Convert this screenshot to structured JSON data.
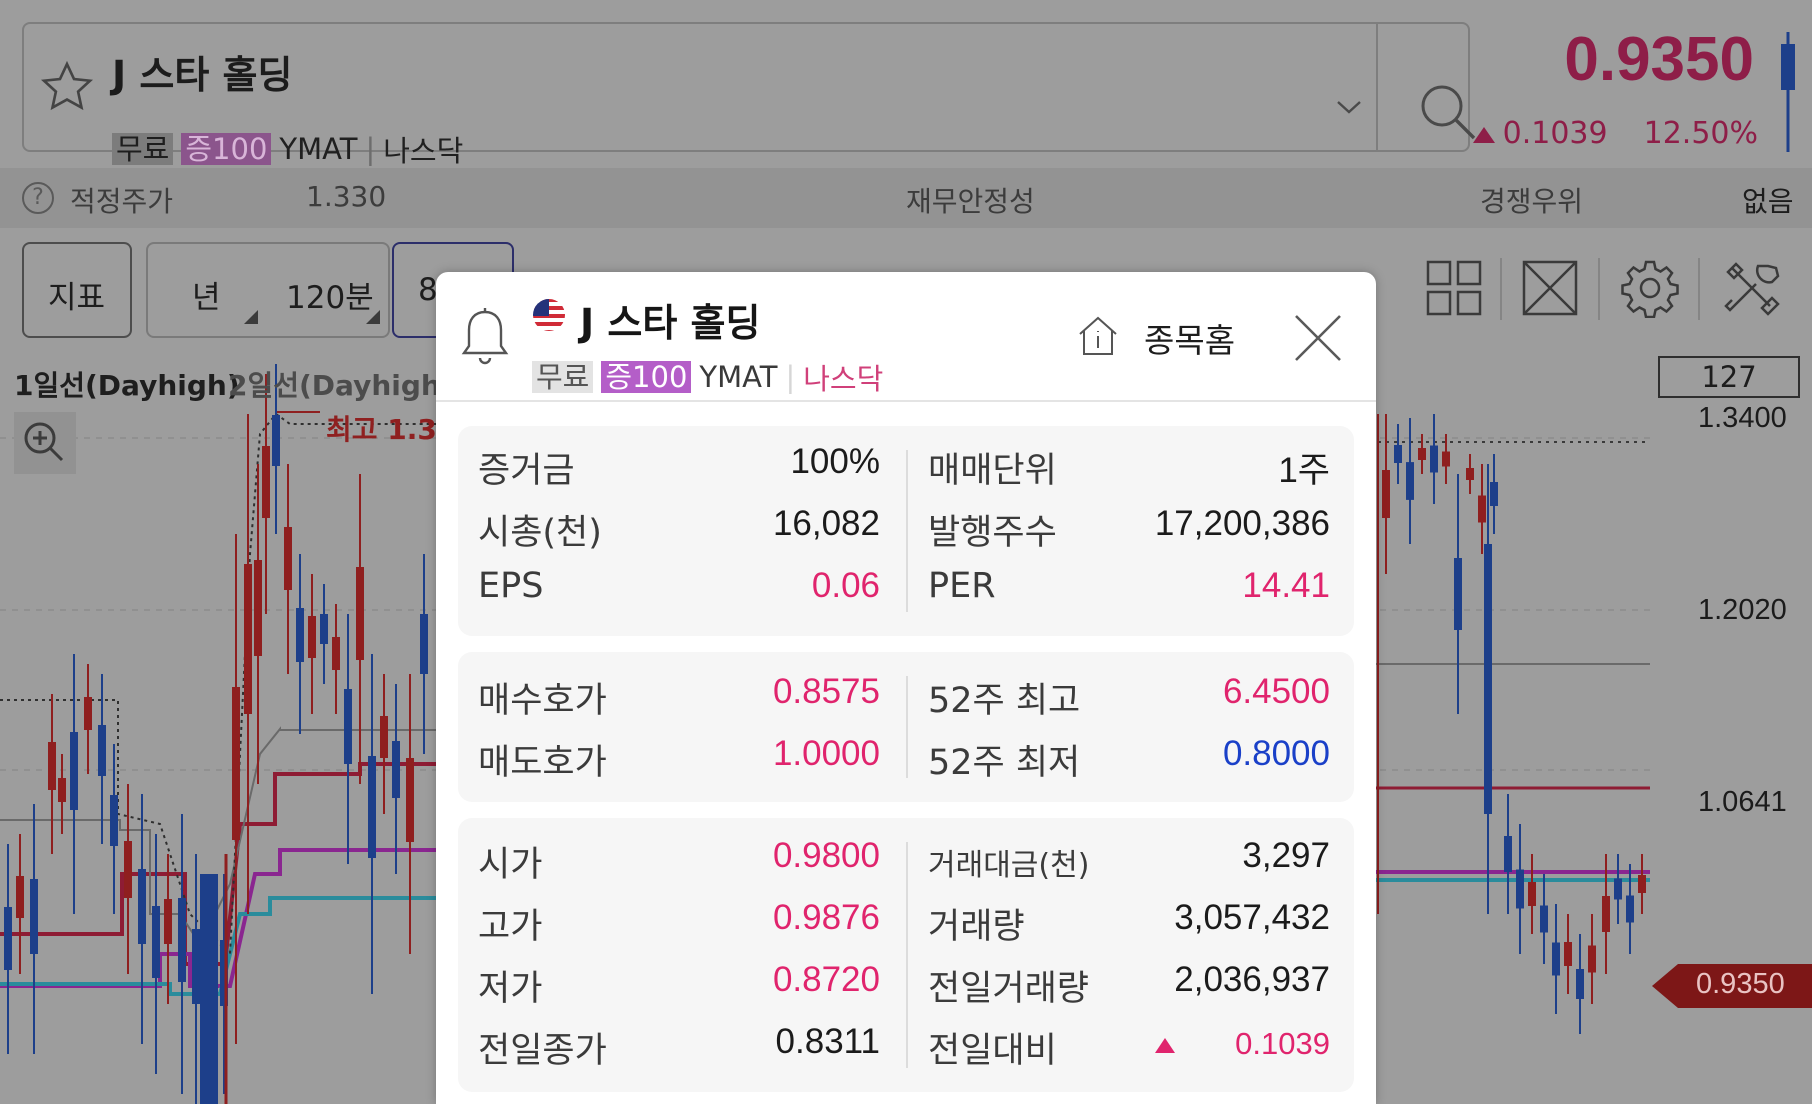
{
  "stock": {
    "name": "J 스타 홀딩",
    "badge_free": "무료",
    "badge_margin": "증100",
    "ticker": "YMAT",
    "exchange": "나스닥"
  },
  "quote": {
    "price": "0.9350",
    "change": "0.1039",
    "change_pct": "12.50%"
  },
  "info_bar": {
    "fair_price_label": "적정주가",
    "fair_price_value": "1.330",
    "financial_stability_label": "재무안정성",
    "competitive_label": "경쟁우위",
    "competitive_value": "없음",
    "help_glyph": "?"
  },
  "toolbar": {
    "indicator_label": "지표",
    "period_year": "년",
    "period_120": "120분",
    "period_partial": "8"
  },
  "chart": {
    "legend_1": "1일선(Dayhigh)",
    "legend_2": "2일선(Dayhigh)",
    "max_label": "최고 1.3",
    "count": "127",
    "y_ticks": [
      "1.3400",
      "1.2020",
      "1.0641"
    ],
    "last_price": "0.9350",
    "colors": {
      "up": "#8f1f1f",
      "down": "#1d3f8a",
      "line_red": "#8e1c34",
      "line_magenta": "#8a2690",
      "line_cyan": "#2a8c9c",
      "line_gray": "#6a6a6a"
    }
  },
  "popup": {
    "stock_home_label": "종목홈",
    "card1": {
      "left": [
        {
          "label": "증거금",
          "value": "100%"
        },
        {
          "label": "시총(천)",
          "value": "16,082"
        },
        {
          "label": "EPS",
          "value": "0.06"
        }
      ],
      "right": [
        {
          "label": "매매단위",
          "value": "1주"
        },
        {
          "label": "발행주수",
          "value": "17,200,386"
        },
        {
          "label": "PER",
          "value": "14.41"
        }
      ]
    },
    "card2": {
      "left": [
        {
          "label": "매수호가",
          "value": "0.8575"
        },
        {
          "label": "매도호가",
          "value": "1.0000"
        }
      ],
      "right": [
        {
          "label": "52주 최고",
          "value": "6.4500"
        },
        {
          "label": "52주 최저",
          "value": "0.8000"
        }
      ]
    },
    "card3": {
      "left": [
        {
          "label": "시가",
          "value": "0.9800"
        },
        {
          "label": "고가",
          "value": "0.9876"
        },
        {
          "label": "저가",
          "value": "0.8720"
        },
        {
          "label": "전일종가",
          "value": "0.8311"
        }
      ],
      "right": [
        {
          "label": "거래대금(천)",
          "value": "3,297"
        },
        {
          "label": "거래량",
          "value": "3,057,432"
        },
        {
          "label": "전일거래량",
          "value": "2,036,937"
        },
        {
          "label": "전일대비",
          "value": "0.1039"
        }
      ]
    },
    "accent_pink": "#e0246d",
    "accent_blue": "#1a40c8"
  }
}
